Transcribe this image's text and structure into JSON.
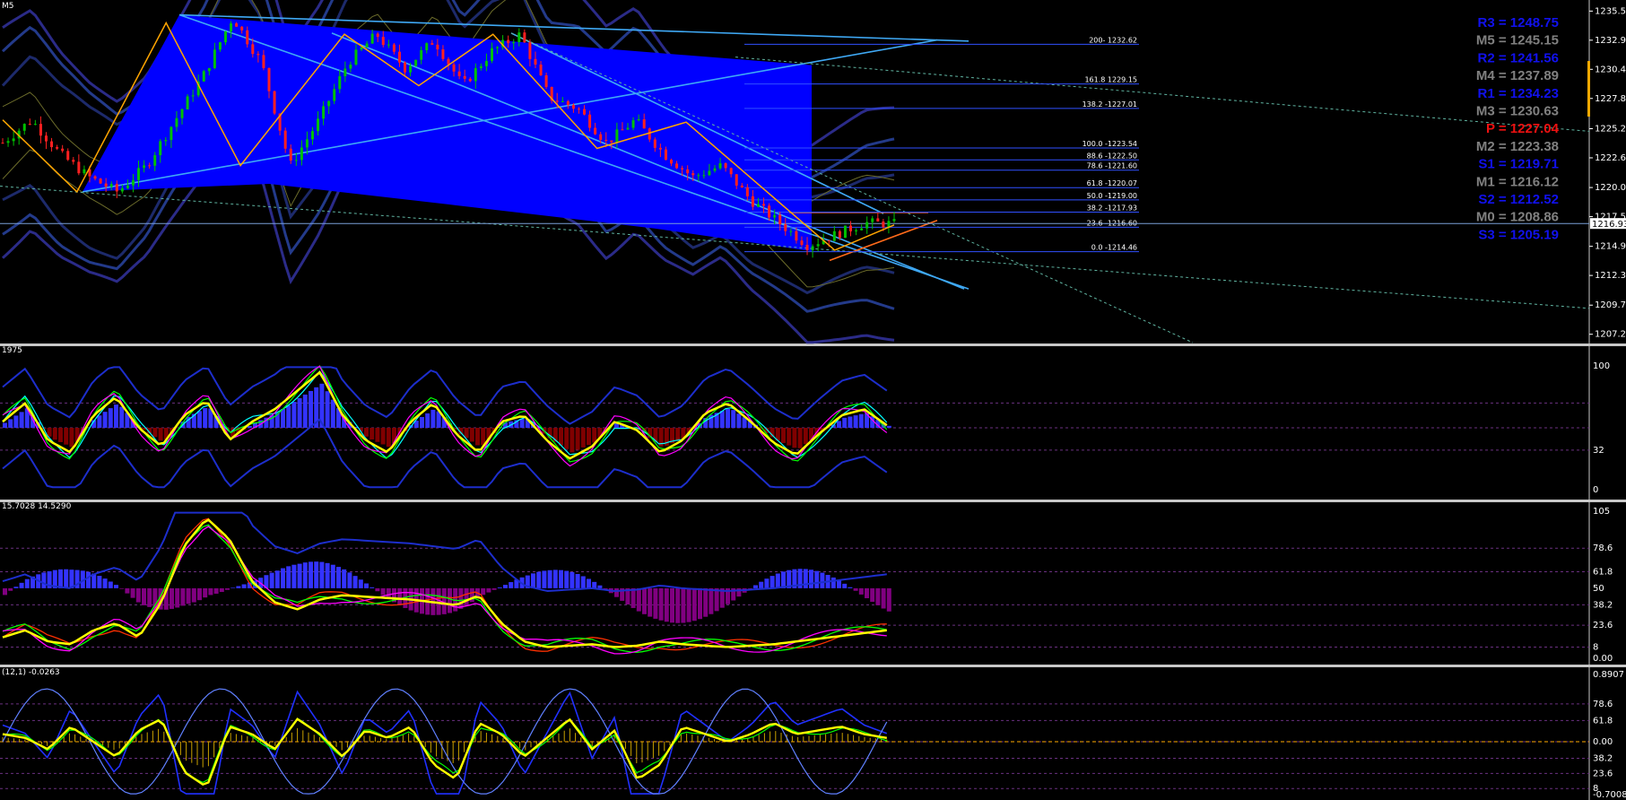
{
  "symbol_label": "M5",
  "pivots": [
    {
      "label": "R3 = 1248.75",
      "color": "#1111ee",
      "value": 1248.75
    },
    {
      "label": "M5 = 1245.15",
      "color": "#808080",
      "value": 1245.15
    },
    {
      "label": "R2 = 1241.56",
      "color": "#1111ee",
      "value": 1241.56
    },
    {
      "label": "M4 = 1237.89",
      "color": "#808080",
      "value": 1237.89
    },
    {
      "label": "R1 = 1234.23",
      "color": "#1111ee",
      "value": 1234.23
    },
    {
      "label": "M3 = 1230.63",
      "color": "#808080",
      "value": 1230.63
    },
    {
      "label": "P   = 1227.04",
      "color": "#ee1111",
      "value": 1227.04
    },
    {
      "label": "M2 = 1223.38",
      "color": "#808080",
      "value": 1223.38
    },
    {
      "label": "S1 = 1219.71",
      "color": "#1111ee",
      "value": 1219.71
    },
    {
      "label": "M1 = 1216.12",
      "color": "#808080",
      "value": 1216.12
    },
    {
      "label": "S2 = 1212.52",
      "color": "#1111ee",
      "value": 1212.52
    },
    {
      "label": "M0 = 1208.86",
      "color": "#808080",
      "value": 1208.86
    },
    {
      "label": "S3 = 1205.19",
      "color": "#1111ee",
      "value": 1205.19
    }
  ],
  "fib_levels": [
    {
      "label": "200- 1232.62",
      "value": 1232.62
    },
    {
      "label": "161.8 1229.15",
      "value": 1229.15
    },
    {
      "label": "138.2 -1227.01",
      "value": 1227.01
    },
    {
      "label": "100.0 -1223.54",
      "value": 1223.54
    },
    {
      "label": "88.6 -1222.50",
      "value": 1222.5
    },
    {
      "label": "78.6 -1221.60",
      "value": 1221.6
    },
    {
      "label": "61.8 -1220.07",
      "value": 1220.07
    },
    {
      "label": "50.0 -1219.00",
      "value": 1219.0
    },
    {
      "label": "38.2 -1217.93",
      "value": 1217.93
    },
    {
      "label": "23.6 -1216.60",
      "value": 1216.6
    },
    {
      "label": "0.0 -1214.46",
      "value": 1214.46
    }
  ],
  "current_price": "1216.93",
  "colors": {
    "fill": "#0000ff",
    "zigzag": "#ffa500",
    "trend": "#3fa9f5",
    "osc_yellow": "#ffff00",
    "histo_up": "#3333ff",
    "histo_down_1": "#800000",
    "histo_down_2": "#800080"
  },
  "panes": [
    {
      "header": "1975",
      "ticks": [
        "100",
        "32",
        "0"
      ]
    },
    {
      "header": "15.7028 14.5290",
      "ticks": [
        "105",
        "78.6",
        "61.8",
        "50",
        "38.2",
        "23.6",
        "8",
        "0.00"
      ]
    },
    {
      "header": "(12,1) -0.0263",
      "ticks": [
        "0.8907",
        "78.6",
        "61.8",
        "0.00",
        "38.2",
        "23.6",
        "8",
        "-0.7008"
      ]
    }
  ],
  "chart_data": [
    {
      "type": "candlestick",
      "title": "",
      "timeframe": "M5",
      "ylim": [
        1206.5,
        1236.5
      ],
      "y_ticks": [
        1235.53,
        1232.98,
        1230.43,
        1227.88,
        1225.23,
        1222.68,
        1220.08,
        1217.53,
        1214.93,
        1212.38,
        1209.78,
        1207.23
      ],
      "price_path": [
        1224,
        1226,
        1223,
        1221,
        1219.7,
        1222,
        1226,
        1230,
        1235,
        1231,
        1222,
        1226,
        1231,
        1233.5,
        1230.5,
        1233,
        1229,
        1232,
        1233.5,
        1228,
        1227,
        1224,
        1226,
        1223,
        1221,
        1222,
        1219,
        1217,
        1215,
        1216,
        1217,
        1216.9
      ],
      "zigzag": [
        [
          0,
          1226
        ],
        [
          5,
          1219.7
        ],
        [
          11,
          1234.5
        ],
        [
          16,
          1222
        ],
        [
          23,
          1233.5
        ],
        [
          28,
          1229
        ],
        [
          33,
          1233.5
        ],
        [
          40,
          1223.5
        ],
        [
          46,
          1225.8
        ],
        [
          56,
          1214.6
        ],
        [
          60,
          1216.8
        ]
      ],
      "current_price": 1216.93
    },
    {
      "type": "line",
      "title": "",
      "ylim": [
        0,
        100
      ],
      "series": [
        {
          "values": [
            55,
            70,
            40,
            30,
            60,
            75,
            50,
            35,
            60,
            72,
            40,
            55,
            65,
            80,
            95,
            60,
            40,
            30,
            55,
            70,
            45,
            30,
            55,
            60,
            40,
            25,
            35,
            55,
            48,
            30,
            40,
            62,
            70,
            55,
            38,
            28,
            45,
            60,
            65,
            52
          ]
        }
      ]
    },
    {
      "type": "line",
      "title": "",
      "ylim": [
        0,
        105
      ],
      "series": [
        {
          "values": [
            15,
            20,
            12,
            10,
            20,
            25,
            15,
            40,
            80,
            100,
            85,
            55,
            40,
            35,
            42,
            45,
            44,
            43,
            42,
            40,
            38,
            45,
            25,
            12,
            8,
            9,
            10,
            8,
            9,
            12,
            10,
            9,
            8,
            9,
            10,
            12,
            14,
            16,
            18,
            20
          ]
        }
      ]
    },
    {
      "type": "line",
      "title": "",
      "ylim": [
        -0.7008,
        0.8907
      ],
      "series": [
        {
          "values": [
            0.1,
            0.05,
            -0.1,
            0.2,
            0.0,
            -0.2,
            0.15,
            0.3,
            -0.4,
            -0.6,
            0.2,
            0.1,
            -0.1,
            0.3,
            0.1,
            -0.2,
            0.15,
            0.05,
            0.2,
            -0.3,
            -0.5,
            0.25,
            0.1,
            -0.2,
            0.05,
            0.3,
            -0.1,
            0.15,
            -0.5,
            -0.3,
            0.2,
            0.1,
            0.0,
            0.1,
            0.25,
            0.1,
            0.15,
            0.2,
            0.1,
            0.05
          ]
        }
      ]
    }
  ]
}
